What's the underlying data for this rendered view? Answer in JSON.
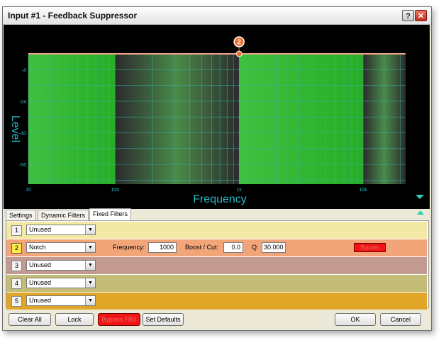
{
  "window": {
    "title": "Input #1 - Feedback Suppressor",
    "help_label": "?",
    "close_label": "✕"
  },
  "graph": {
    "y_axis_label": "Level",
    "x_axis_label": "Frequency",
    "x_ticks": [
      {
        "label": "20",
        "hz": 20
      },
      {
        "label": "100",
        "hz": 100
      },
      {
        "label": "1k",
        "hz": 1000
      },
      {
        "label": "10k",
        "hz": 10000
      }
    ],
    "y_ticks": [
      {
        "label": "-8",
        "db": -8
      },
      {
        "label": "-24",
        "db": -24
      },
      {
        "label": "-40",
        "db": -40
      },
      {
        "label": "-56",
        "db": -56
      }
    ],
    "x_range_hz": [
      20,
      22000
    ],
    "y_range_db": [
      -66,
      0
    ],
    "marker": {
      "label": "2",
      "hz": 1000,
      "db": 0
    },
    "colors": {
      "green": "#2bb82b",
      "grid": "#38b3b3",
      "label": "#21b8c6",
      "marker": "#f26d2a",
      "curve": "#f0a58a"
    }
  },
  "tabs": [
    {
      "label": "Settings",
      "active": false
    },
    {
      "label": "Dynamic Filters",
      "active": false
    },
    {
      "label": "Fixed Filters",
      "active": true
    }
  ],
  "filters": [
    {
      "num": "1",
      "type": "Unused",
      "color": "#f3e9a6",
      "selected": false
    },
    {
      "num": "2",
      "type": "Notch",
      "color": "#f3a57a",
      "selected": true,
      "frequency_label": "Frequency:",
      "frequency": "1000",
      "boost_label": "Boost / Cut:",
      "boost": "0.0",
      "q_label": "Q:",
      "q": "30.000",
      "bypass_label": "Bypass"
    },
    {
      "num": "3",
      "type": "Unused",
      "color": "#c39a92",
      "selected": false
    },
    {
      "num": "4",
      "type": "Unused",
      "color": "#c4bd78",
      "selected": false
    },
    {
      "num": "5",
      "type": "Unused",
      "color": "#e0a628",
      "selected": false
    }
  ],
  "buttons": {
    "clear_all": "Clear All",
    "lock": "Lock",
    "bypass_fbs": "Bypass FBS",
    "set_defaults": "Set Defaults",
    "ok": "OK",
    "cancel": "Cancel"
  }
}
